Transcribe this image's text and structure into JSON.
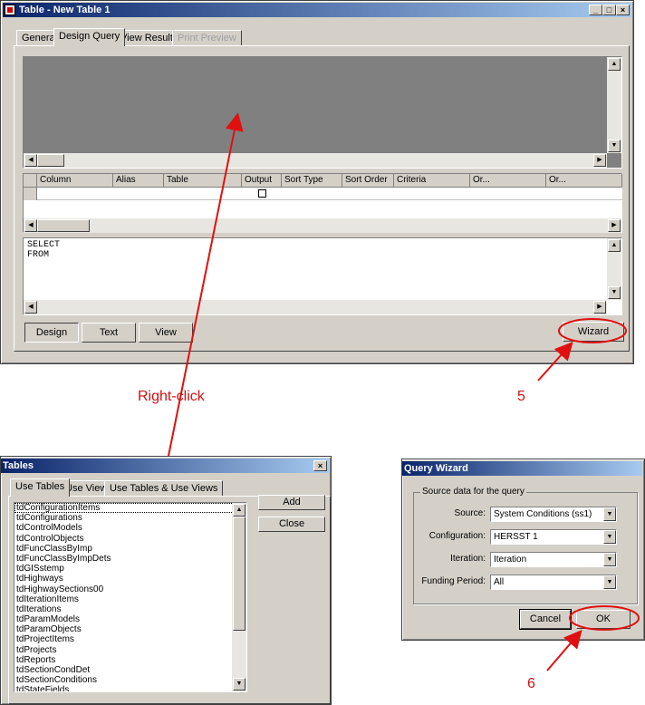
{
  "main_window": {
    "title": "Table - New Table 1",
    "controls": {
      "minimize": "_",
      "maximize": "□",
      "close": "×"
    },
    "tabs": [
      {
        "label": "General",
        "state": "normal"
      },
      {
        "label": "Design Query",
        "state": "active"
      },
      {
        "label": "View Results",
        "state": "normal"
      },
      {
        "label": "Print Preview",
        "state": "disabled"
      }
    ],
    "grid_columns": [
      "Column",
      "Alias",
      "Table",
      "Output",
      "Sort Type",
      "Sort Order",
      "Criteria",
      "Or...",
      "Or..."
    ],
    "sql_text": "SELECT\nFROM",
    "bottom_buttons": {
      "design": "Design",
      "text": "Text",
      "view": "View",
      "wizard": "Wizard"
    }
  },
  "annotations": {
    "right_click": "Right-click",
    "step5": "5",
    "step6": "6"
  },
  "tables_window": {
    "title": "Tables",
    "close": "×",
    "tabs": [
      {
        "label": "Use Tables",
        "state": "active"
      },
      {
        "label": "Use Views",
        "state": "normal"
      },
      {
        "label": "Use Tables & Use Views",
        "state": "normal"
      }
    ],
    "items": [
      "tdConfigurationItems",
      "tdConfigurations",
      "tdControlModels",
      "tdControlObjects",
      "tdFuncClassByImp",
      "tdFuncClassByImpDets",
      "tdGISstemp",
      "tdHighways",
      "tdHighwaySections00",
      "tdIterationItems",
      "tdIterations",
      "tdParamModels",
      "tdParamObjects",
      "tdProjectItems",
      "tdProjects",
      "tdReports",
      "tdSectionCondDet",
      "tdSectionConditions",
      "tdStateFields"
    ],
    "buttons": {
      "add": "Add",
      "close": "Close"
    }
  },
  "wizard_window": {
    "title": "Query Wizard",
    "group_label": "Source data for the query",
    "fields": [
      {
        "label": "Source:",
        "value": "System Conditions (ss1)"
      },
      {
        "label": "Configuration:",
        "value": "HERSST 1"
      },
      {
        "label": "Iteration:",
        "value": "Iteration"
      },
      {
        "label": "Funding Period:",
        "value": "All"
      }
    ],
    "buttons": {
      "cancel": "Cancel",
      "ok": "OK"
    }
  },
  "colors": {
    "annotation": "#e01010",
    "titlebar": "#0a246a",
    "face": "#d4d0c8"
  }
}
